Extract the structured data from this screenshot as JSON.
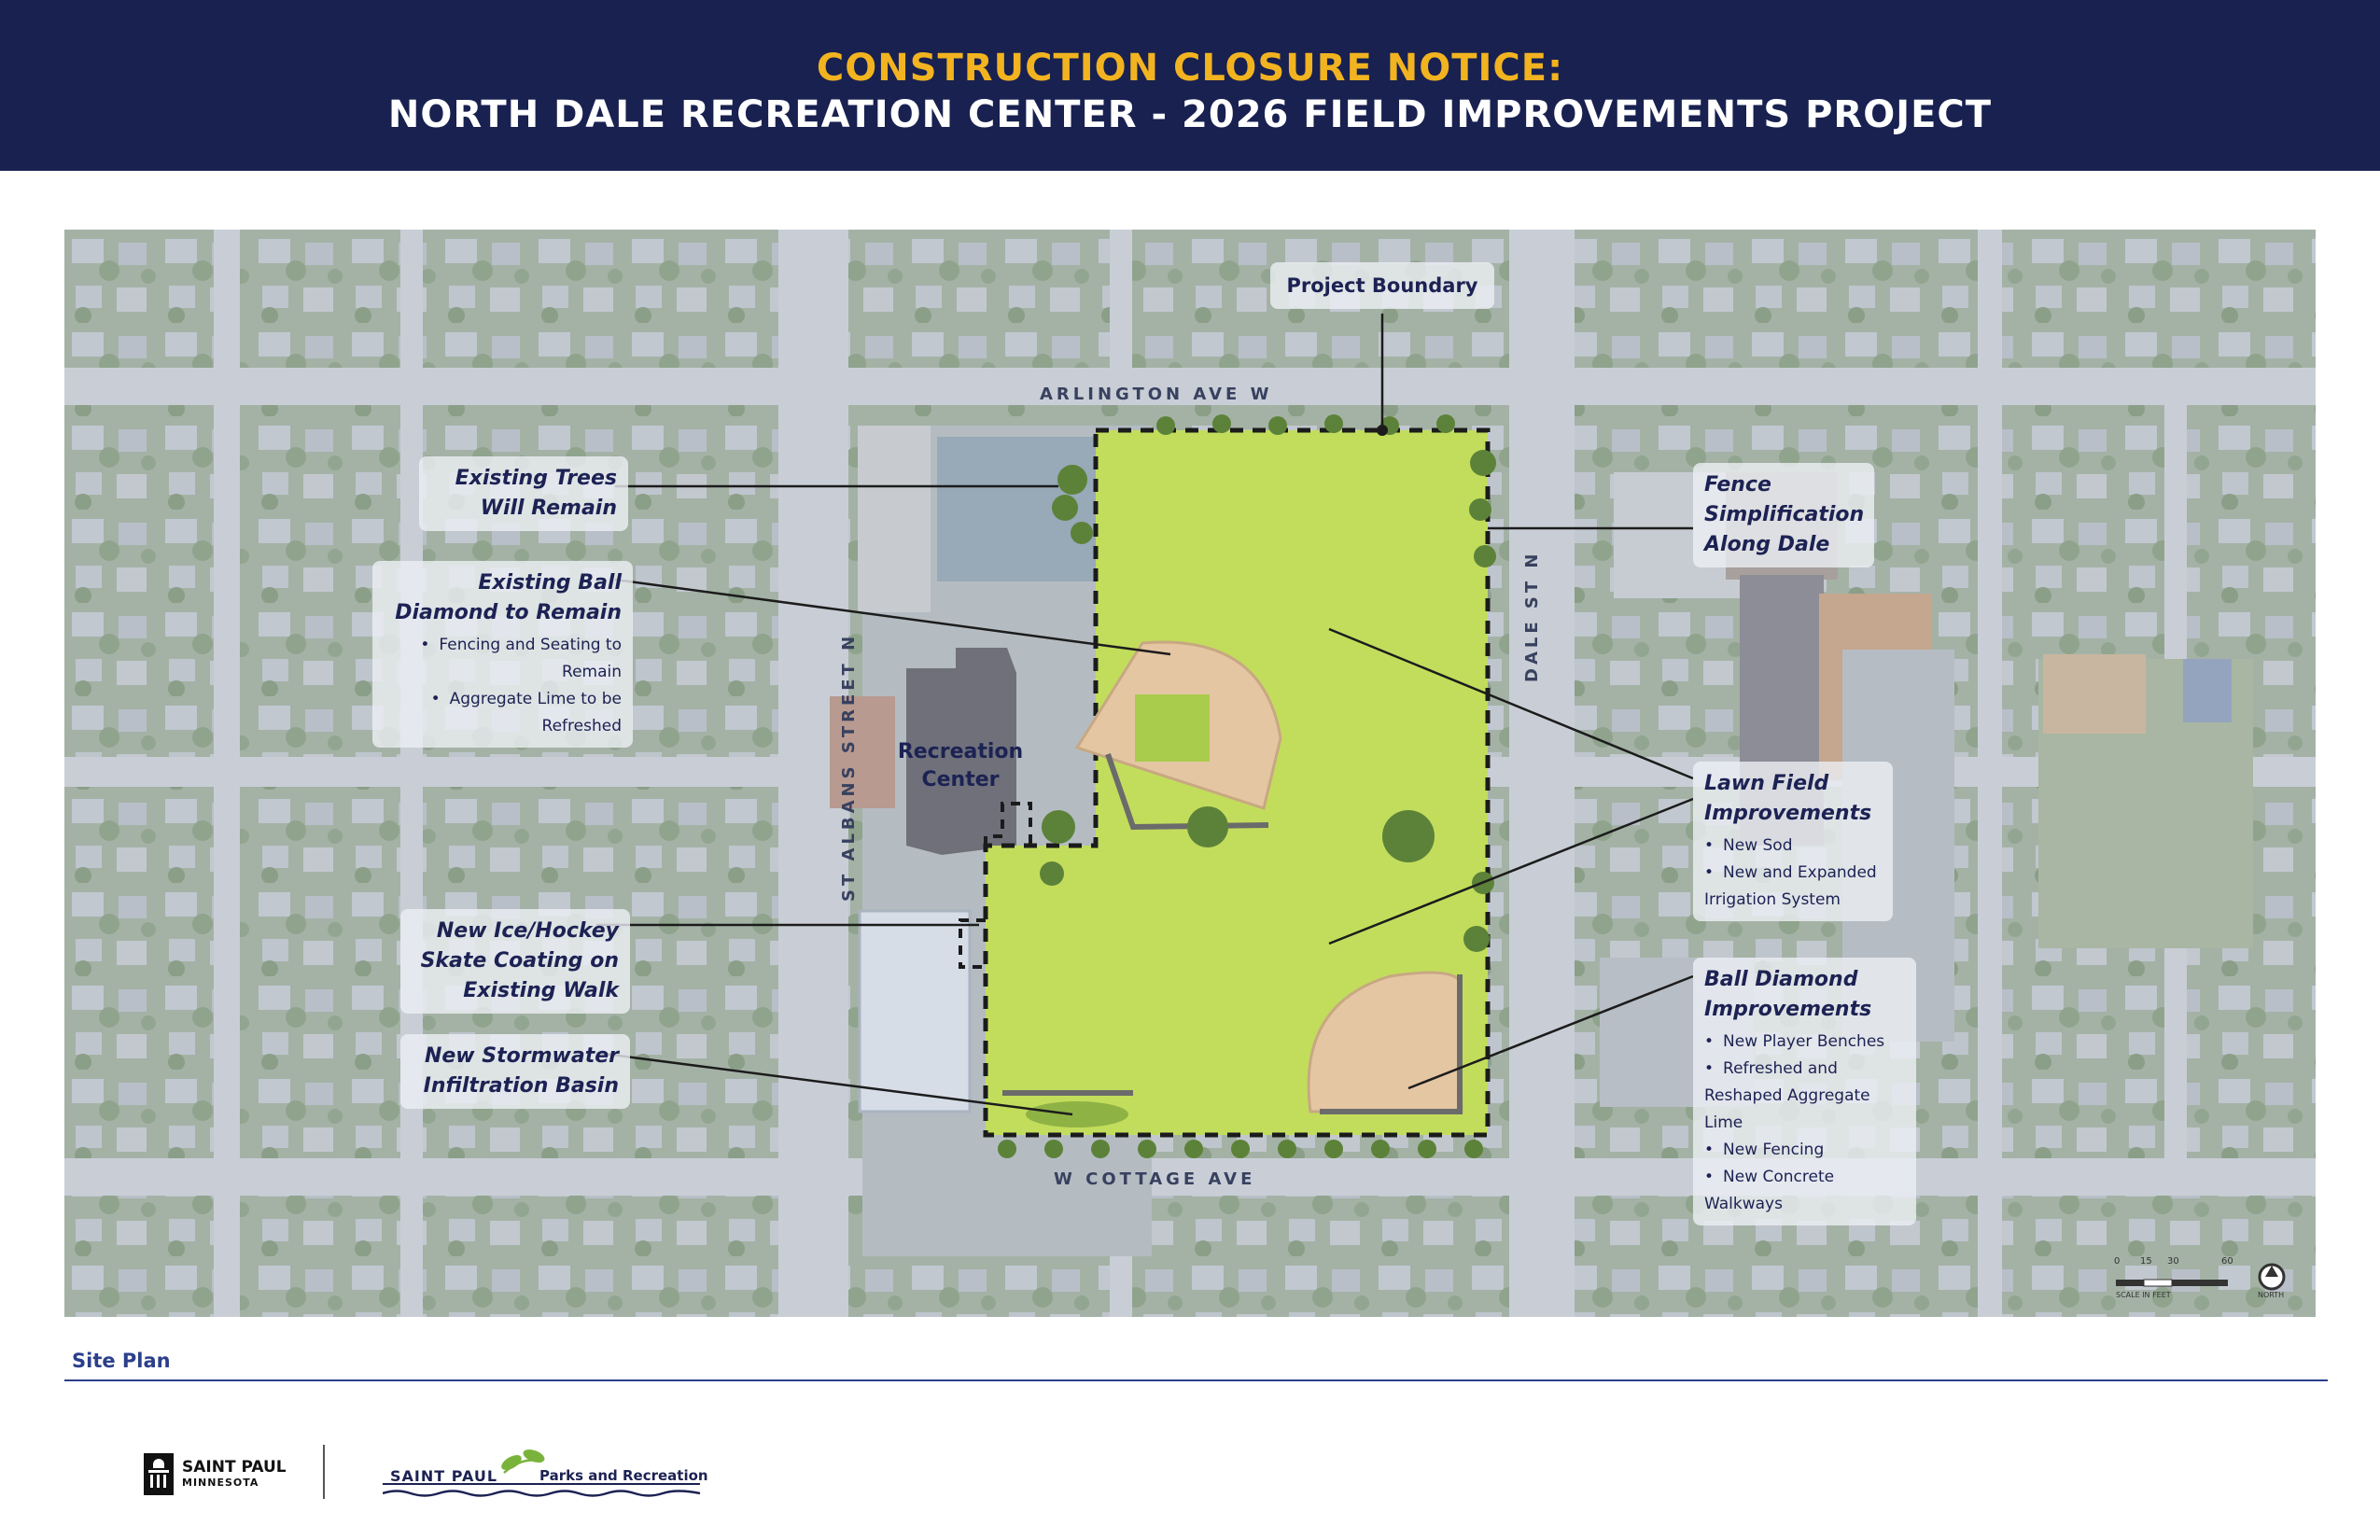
{
  "header": {
    "line1": "CONSTRUCTION CLOSURE NOTICE:",
    "line2": "NORTH DALE RECREATION CENTER - 2026 FIELD IMPROVEMENTS PROJECT"
  },
  "colors": {
    "header_bg": "#182150",
    "header_accent": "#f2b320",
    "lawn": "#c2dd5c",
    "diamond_infield": "#e5c6a3",
    "label_text": "#1c2253"
  },
  "streets": {
    "arlington": "ARLINGTON AVE W",
    "cottage": "W COTTAGE AVE",
    "st_albans": "ST ALBANS STREET N",
    "dale": "DALE ST N"
  },
  "map_labels": {
    "project_boundary": "Project Boundary",
    "rec_center_line1": "Recreation",
    "rec_center_line2": "Center"
  },
  "callouts": {
    "trees": {
      "title": "Existing Trees Will Remain"
    },
    "ball_remain": {
      "title": "Existing Ball Diamond to Remain",
      "items": [
        "Fencing and Seating to Remain",
        "Aggregate Lime to be Refreshed"
      ]
    },
    "ice": {
      "title": "New Ice/Hockey Skate Coating on Existing Walk"
    },
    "storm": {
      "title": "New Stormwater Infiltration Basin"
    },
    "fence": {
      "title": "Fence Simplification Along Dale"
    },
    "lawn": {
      "title": "Lawn Field Improvements",
      "items": [
        "New Sod",
        "New and Expanded Irrigation System"
      ]
    },
    "ball_improve": {
      "title": "Ball Diamond Improvements",
      "items": [
        "New Player Benches",
        "Refreshed and Reshaped Aggregate Lime",
        "New Fencing",
        "New Concrete Walkways"
      ]
    }
  },
  "scale": {
    "ticks": [
      "0",
      "15",
      "30",
      "60"
    ],
    "scale_label": "SCALE IN FEET",
    "north_label": "NORTH"
  },
  "footer": {
    "site_plan": "Site Plan",
    "city_name": "SAINT PAUL",
    "city_state": "MINNESOTA",
    "parks_city": "SAINT PAUL",
    "parks_dept": "Parks and Recreation"
  }
}
